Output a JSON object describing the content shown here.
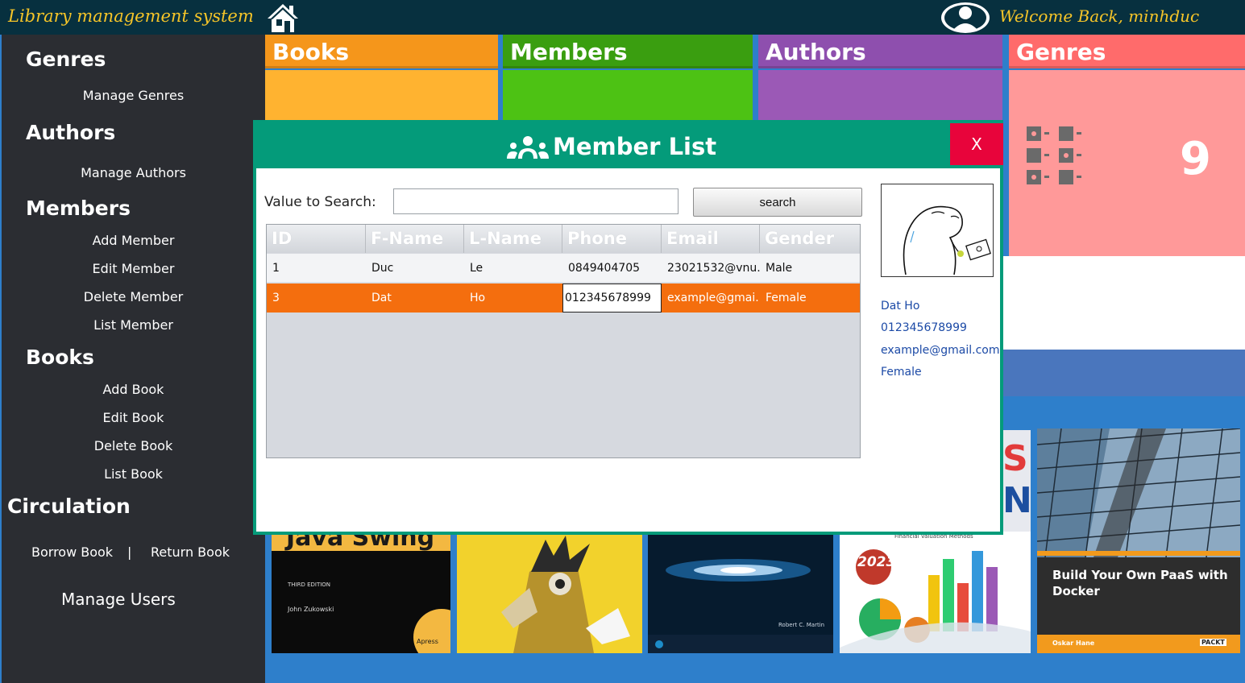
{
  "header": {
    "app_title": "Library management system",
    "welcome": "Welcome Back, minhduc"
  },
  "sidebar": {
    "genres_heading": "Genres",
    "manage_genres": "Manage Genres",
    "authors_heading": "Authors",
    "manage_authors": "Manage Authors",
    "members_heading": "Members",
    "add_member": "Add Member",
    "edit_member": "Edit Member",
    "delete_member": "Delete Member",
    "list_member": "List Member",
    "books_heading": "Books",
    "add_book": "Add Book",
    "edit_book": "Edit Book",
    "delete_book": "Delete Book",
    "list_book": "List Book",
    "circulation_heading": "Circulation",
    "borrow_book": "Borrow Book",
    "separator": "|",
    "return_book": "Return Book",
    "manage_users": "Manage Users"
  },
  "tiles": {
    "books": {
      "label": "Books",
      "head_color": "#f5961b",
      "body_color": "#ffb330"
    },
    "members": {
      "label": "Members",
      "head_color": "#3a9e10",
      "body_color": "#4dc214"
    },
    "authors": {
      "label": "Authors",
      "head_color": "#8e4fae",
      "body_color": "#9b59b6"
    },
    "genres": {
      "label": "Genres",
      "count": "9",
      "head_color": "#ff6b6b",
      "body_color": "#ff9999"
    }
  },
  "modal": {
    "title": "Member List",
    "close_label": "X",
    "search_label": "Value to Search:",
    "search_value": "",
    "search_button": "search",
    "columns": [
      "ID",
      "F-Name",
      "L-Name",
      "Phone",
      "Email",
      "Gender"
    ],
    "rows": [
      {
        "id": "1",
        "fname": "Duc",
        "lname": "Le",
        "phone": "0849404705",
        "email": "23021532@vnu...",
        "gender": "Male"
      },
      {
        "id": "3",
        "fname": "Dat",
        "lname": "Ho",
        "phone": "012345678999",
        "email": "example@gmai...",
        "gender": "Female"
      }
    ],
    "selected": {
      "name": "Dat Ho",
      "phone": "012345678999",
      "email": "example@gmail.com",
      "gender": "Female"
    }
  },
  "books": {
    "swing_title": "Java Swing",
    "swing_edition": "THIRD EDITION",
    "swing_author": "John Zukowski",
    "swing_publisher": "Apress",
    "clean_author": "Robert C. Martin",
    "fin_year": "2023",
    "fin_subtitle": "Financial Valuation Methods",
    "paas_title": "Build Your Own PaaS with Docker",
    "paas_author": "Oskar Hane",
    "paas_publisher": "PACKT"
  },
  "colors": {
    "topbar": "#07303f",
    "sidebar": "#2b2d32",
    "accent_title": "#f6c528",
    "modal_header": "#049b7a",
    "close_button": "#e8043b",
    "row_selected": "#f46e0e",
    "detail_text": "#1c4aa6"
  }
}
